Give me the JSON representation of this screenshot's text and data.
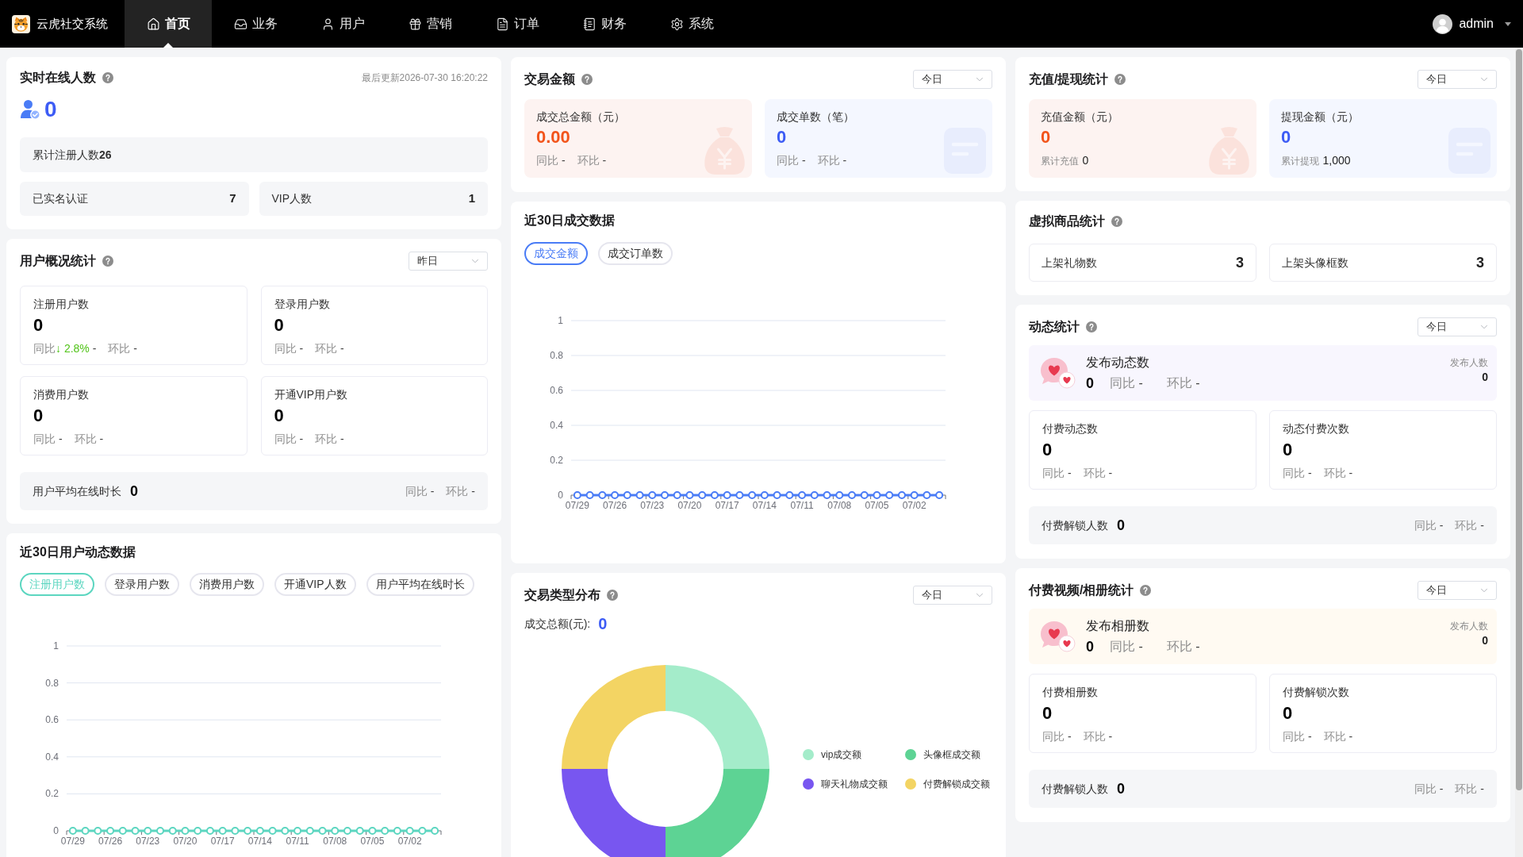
{
  "top_nav": {
    "app_name": "云虎社交系统",
    "tabs": [
      {
        "kind": "home",
        "label": "首页",
        "selected": true
      },
      {
        "kind": "business",
        "label": "业务",
        "selected": false
      },
      {
        "kind": "users",
        "label": "用户",
        "selected": false
      },
      {
        "kind": "marketing",
        "label": "营销",
        "selected": false
      },
      {
        "kind": "orders",
        "label": "订单",
        "selected": false
      },
      {
        "kind": "finance",
        "label": "财务",
        "selected": false
      },
      {
        "kind": "system",
        "label": "系统",
        "selected": false
      }
    ],
    "user": "admin"
  },
  "online_users": {
    "title": "实时在线人数",
    "help": true,
    "last_updated": "最后更新2026-07-30 16:20:22",
    "count": "0",
    "total_registered": "累计注册人数**26**",
    "stats": [
      {
        "label": "已实名认证",
        "value": "7"
      },
      {
        "label": "VIP人数",
        "value": "1"
      }
    ]
  },
  "user_overview": {
    "title": "用户概况统计",
    "help": true,
    "period": "昨日",
    "metrics": [
      {
        "label": "注册用户数",
        "value": "0",
        "compare": [
          {
            "label": "同比",
            "change": "↓ 2.8%",
            "falling": true,
            "value": "-"
          },
          {
            "label": "环比",
            "value": "-"
          }
        ]
      },
      {
        "label": "登录用户数",
        "value": "0",
        "compare": [
          {
            "label": "同比",
            "value": "-"
          },
          {
            "label": "环比",
            "value": "-"
          }
        ]
      },
      {
        "label": "消费用户数",
        "value": "0",
        "compare": [
          {
            "label": "同比",
            "value": "-"
          },
          {
            "label": "环比",
            "value": "-"
          }
        ]
      },
      {
        "label": "开通VIP用户数",
        "value": "0",
        "compare": [
          {
            "label": "同比",
            "value": "-"
          },
          {
            "label": "环比",
            "value": "-"
          }
        ]
      }
    ],
    "average_online": {
      "label": "用户平均在线时长",
      "value": "0",
      "compare": [
        {
          "label": "同比",
          "value": "-"
        },
        {
          "label": "环比",
          "value": "-"
        }
      ]
    }
  },
  "user_trend": {
    "title": "近30日用户动态数据",
    "tabs": [
      {
        "label": "注册用户数",
        "selected": true
      },
      {
        "label": "登录用户数",
        "selected": false
      },
      {
        "label": "消费用户数",
        "selected": false
      },
      {
        "label": "开通VIP人数",
        "selected": false
      },
      {
        "label": "用户平均在线时长",
        "selected": false
      }
    ],
    "chart_data": {
      "type": "line",
      "grid": true,
      "categories": [
        "07/29",
        null,
        null,
        "07/26",
        null,
        null,
        "07/23",
        null,
        null,
        "07/20",
        null,
        null,
        "07/17",
        null,
        null,
        "07/14",
        null,
        null,
        "07/11",
        null,
        null,
        "07/08",
        null,
        null,
        "07/05",
        null,
        null,
        "07/02",
        null,
        null
      ],
      "ylim": [
        0,
        1
      ],
      "yticks": [
        0,
        0.2,
        0.4,
        0.6,
        0.8,
        1
      ],
      "series": [
        {
          "color": "#5cd6c0",
          "marker": "circle",
          "values": [
            0,
            0,
            0,
            0,
            0,
            0,
            0,
            0,
            0,
            0,
            0,
            0,
            0,
            0,
            0,
            0,
            0,
            0,
            0,
            0,
            0,
            0,
            0,
            0,
            0,
            0,
            0,
            0,
            0,
            0
          ]
        }
      ]
    }
  },
  "transaction_amount": {
    "title": "交易金额",
    "help": true,
    "period": "今日",
    "cards": [
      {
        "kind": "sales",
        "label": "成交总金额（元）",
        "value": "0.00",
        "compare": [
          {
            "label": "同比",
            "value": "-"
          },
          {
            "label": "环比",
            "value": "-"
          }
        ]
      },
      {
        "kind": "orders",
        "label": "成交单数（笔）",
        "value": "0",
        "compare": [
          {
            "label": "同比",
            "value": "-"
          },
          {
            "label": "环比",
            "value": "-"
          }
        ]
      }
    ]
  },
  "transaction_trend": {
    "title": "近30日成交数据",
    "tabs": [
      {
        "label": "成交金额",
        "selected": true
      },
      {
        "label": "成交订单数",
        "selected": false
      }
    ],
    "chart_data": {
      "type": "line",
      "grid": true,
      "categories": [
        "07/29",
        null,
        null,
        "07/26",
        null,
        null,
        "07/23",
        null,
        null,
        "07/20",
        null,
        null,
        "07/17",
        null,
        null,
        "07/14",
        null,
        null,
        "07/11",
        null,
        null,
        "07/08",
        null,
        null,
        "07/05",
        null,
        null,
        "07/02",
        null,
        null
      ],
      "ylim": [
        0,
        1
      ],
      "yticks": [
        0,
        0.2,
        0.4,
        0.6,
        0.8,
        1
      ],
      "series": [
        {
          "color": "#4a7cf6",
          "marker": "circle",
          "values": [
            0,
            0,
            0,
            0,
            0,
            0,
            0,
            0,
            0,
            0,
            0,
            0,
            0,
            0,
            0,
            0,
            0,
            0,
            0,
            0,
            0,
            0,
            0,
            0,
            0,
            0,
            0,
            0,
            0,
            0
          ]
        }
      ]
    }
  },
  "transaction_types": {
    "title": "交易类型分布",
    "help": true,
    "period": "今日",
    "total_label": "成交总额(元):",
    "total": "0",
    "legend": [
      {
        "label": "vip成交额",
        "color": "#a4ecca"
      },
      {
        "label": "头像框成交额",
        "color": "#5dd394"
      },
      {
        "label": "聊天礼物成交额",
        "color": "#7856f0"
      },
      {
        "label": "付费解锁成交额",
        "color": "#f3d463"
      }
    ]
  },
  "recharge_withdrawal": {
    "title": "充值/提现统计",
    "help": true,
    "period": "今日",
    "cards": [
      {
        "kind": "recharge",
        "label": "充值金额（元）",
        "value": "0",
        "total_label": "累计充值",
        "total": "0"
      },
      {
        "kind": "withdrawal",
        "label": "提现金额（元）",
        "value": "0",
        "total_label": "累计提现",
        "total": "1,000"
      }
    ]
  },
  "virtual_goods": {
    "title": "虚拟商品统计",
    "help": true,
    "stats": [
      {
        "label": "上架礼物数",
        "value": "3"
      },
      {
        "label": "上架头像框数",
        "value": "3"
      }
    ]
  },
  "posts": {
    "title": "动态统计",
    "help": true,
    "period": "今日",
    "highlight": {
      "kind": "posts",
      "label": "发布动态数",
      "value": "0",
      "compare": [
        {
          "label": "同比",
          "value": "-"
        },
        {
          "label": "环比",
          "value": "-"
        }
      ],
      "publisher_label": "发布人数",
      "publisher_count": "0"
    },
    "metrics": [
      {
        "label": "付费动态数",
        "value": "0",
        "compare": [
          {
            "label": "同比",
            "value": "-"
          },
          {
            "label": "环比",
            "value": "-"
          }
        ]
      },
      {
        "label": "动态付费次数",
        "value": "0",
        "compare": [
          {
            "label": "同比",
            "value": "-"
          },
          {
            "label": "环比",
            "value": "-"
          }
        ]
      }
    ],
    "unlock": {
      "label": "付费解锁人数",
      "value": "0",
      "compare": [
        {
          "label": "同比",
          "value": "-"
        },
        {
          "label": "环比",
          "value": "-"
        }
      ]
    }
  },
  "albums": {
    "title": "付费视频/相册统计",
    "help": true,
    "period": "今日",
    "highlight": {
      "kind": "albums",
      "label": "发布相册数",
      "value": "0",
      "compare": [
        {
          "label": "同比",
          "value": "-"
        },
        {
          "label": "环比",
          "value": "-"
        }
      ],
      "publisher_label": "发布人数",
      "publisher_count": "0"
    },
    "metrics": [
      {
        "label": "付费相册数",
        "value": "0",
        "compare": [
          {
            "label": "同比",
            "value": "-"
          },
          {
            "label": "环比",
            "value": "-"
          }
        ]
      },
      {
        "label": "付费解锁次数",
        "value": "0",
        "compare": [
          {
            "label": "同比",
            "value": "-"
          },
          {
            "label": "环比",
            "value": "-"
          }
        ]
      }
    ],
    "unlock": {
      "label": "付费解锁人数",
      "value": "0",
      "compare": [
        {
          "label": "同比",
          "value": "-"
        },
        {
          "label": "环比",
          "value": "-"
        }
      ]
    }
  }
}
